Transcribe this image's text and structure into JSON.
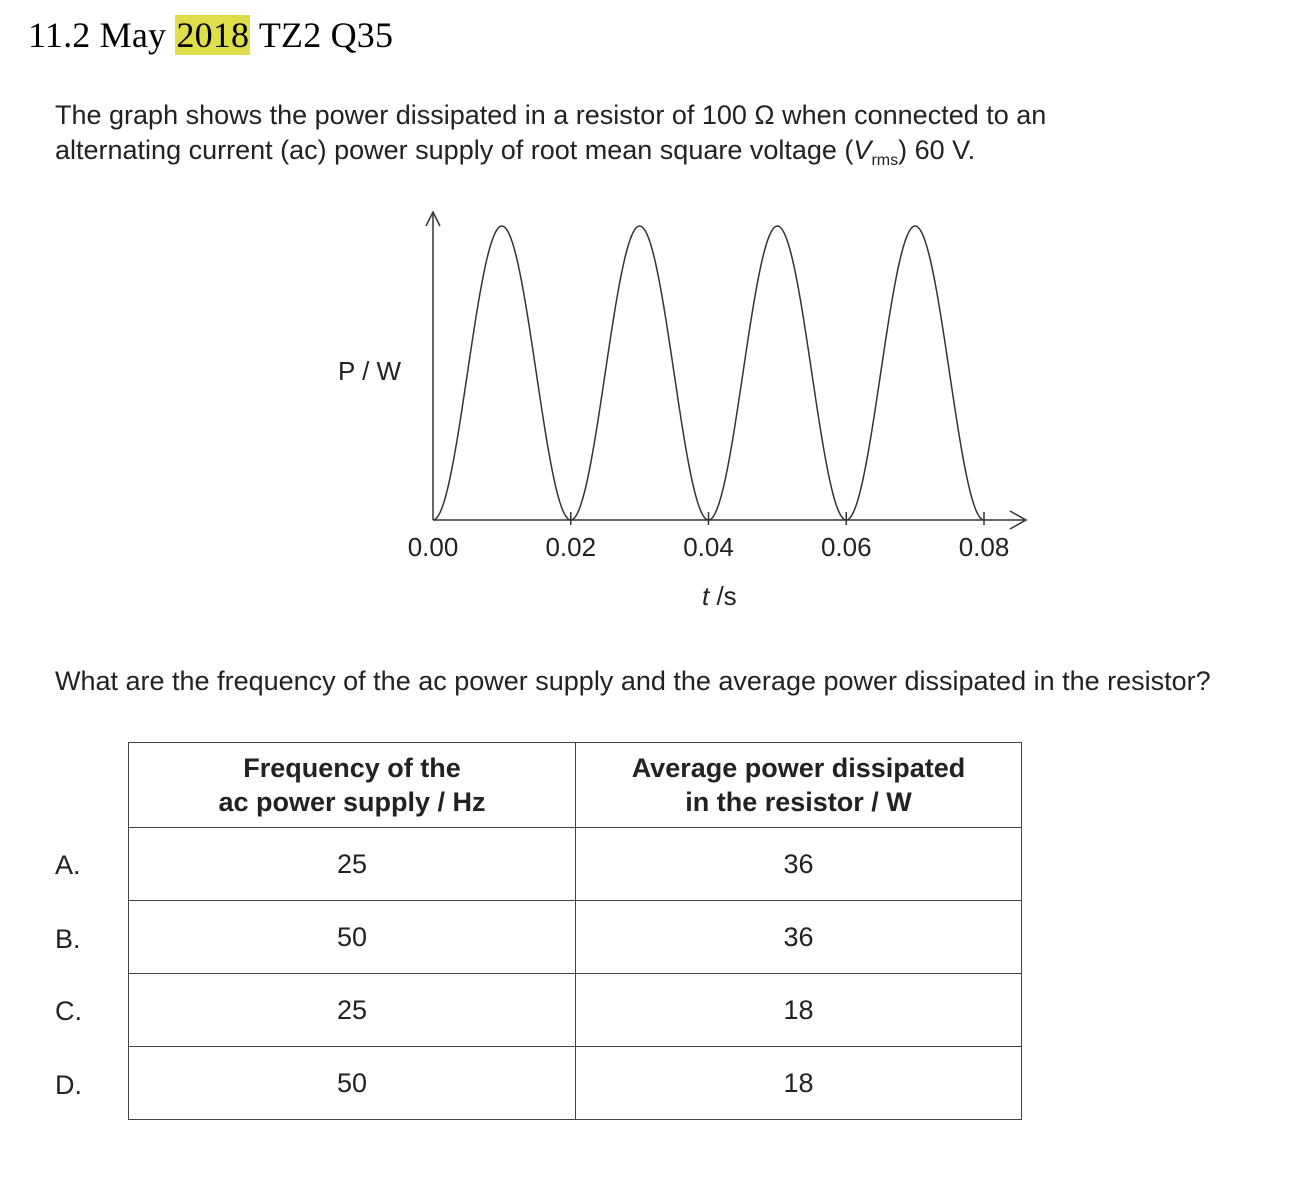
{
  "heading": {
    "prefix": "11.2 May ",
    "highlight": "2018",
    "suffix": " TZ2 Q35"
  },
  "stem": {
    "line1": "The graph shows the power dissipated in a resistor of 100 Ω when connected to an",
    "line2_pre": "alternating current (ac) power supply of root mean square voltage (",
    "line2_var": "V",
    "line2_sub": "rms",
    "line2_post": ") 60 V."
  },
  "chart_data": {
    "type": "line",
    "ylabel": "P / W",
    "xlabel_var": "t",
    "xlabel_unit": " /s",
    "xticks": [
      "0.00",
      "0.02",
      "0.04",
      "0.06",
      "0.08"
    ],
    "xlim": [
      0,
      0.08
    ],
    "series": [
      {
        "x": [
          0.0,
          0.005,
          0.01,
          0.015,
          0.02,
          0.025,
          0.03,
          0.035,
          0.04,
          0.045,
          0.05,
          0.055,
          0.06,
          0.065,
          0.07,
          0.075,
          0.08
        ],
        "y": [
          0,
          0.5,
          1,
          0.5,
          0,
          0.5,
          1,
          0.5,
          0,
          0.5,
          1,
          0.5,
          0,
          0.5,
          1,
          0.5,
          0
        ]
      }
    ]
  },
  "question": "What are the frequency of the ac power supply and the average power dissipated in the resistor?",
  "table": {
    "header_col1_line1": "Frequency of the",
    "header_col1_line2": "ac power supply / Hz",
    "header_col2_line1": "Average power dissipated",
    "header_col2_line2": "in the resistor / W",
    "rows": [
      {
        "letter": "A.",
        "freq": "25",
        "power": "36"
      },
      {
        "letter": "B.",
        "freq": "50",
        "power": "36"
      },
      {
        "letter": "C.",
        "freq": "25",
        "power": "18"
      },
      {
        "letter": "D.",
        "freq": "50",
        "power": "18"
      }
    ]
  }
}
